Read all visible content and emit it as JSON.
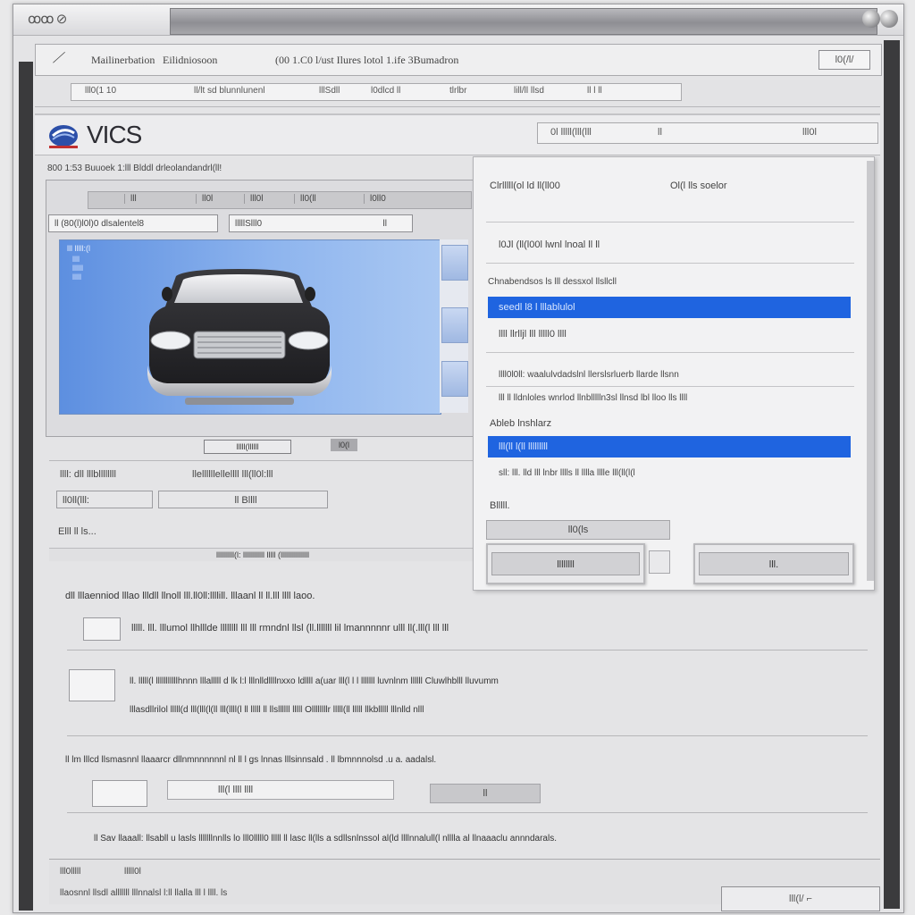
{
  "window": {
    "title_glyph": "ꝏꝏ ⊘",
    "accent_color": "#1f64e0"
  },
  "menubar": {
    "doc_icon": "document-icon",
    "item1": "Mailinerbation",
    "item2": "Eilidniosoon",
    "item3": "(00 1.C0 l/ust Ilures lotol 1.ife 3Bumadron",
    "right_button": "l0(/l/"
  },
  "toolbar": {
    "items": [
      "lll0(1 10",
      "ll/lt sd blunnlunenl",
      "lllSdll",
      "l0dlcd  ll",
      "tlrlbr",
      "lill/ll  llsd",
      "ll l ll"
    ]
  },
  "header": {
    "app_name": "VICS",
    "dropdown_left": "0l  lllll(lll(lll",
    "dropdown_mid": "ll",
    "dropdown_right": "lll0l"
  },
  "left_panel": {
    "heading": "800 1:53 Buuoek     1:lll Blddl drleolandandrl(ll!",
    "tabs": [
      "lll",
      "ll0l",
      "lll0l",
      "ll0(ll",
      "l0ll0"
    ],
    "combo1": "ll (80(l)l0l)0  dlsalentel8",
    "combo2": "lllllSlll0",
    "combo2_value": "ll",
    "viewer_label": "lll lllll:(l",
    "viewer_sub": [
      "llll",
      "llllll",
      "lllll"
    ],
    "viewer_caption": "lllll(llllll",
    "viewer_zoom": "l0(l",
    "row1_label": "llll: dll  lllbllllllll",
    "row1_value": "llellllllellellll lll(ll0l:lll",
    "field1": "ll0ll(lll:",
    "field2": "ll  Bllll",
    "row3_label": "Elll ll ls...",
    "status": "llllllllll(l: llllllllllll lllll (llllllllllllllll"
  },
  "right_panel": {
    "line1_left": "Clrlllll(ol ld ll(ll00",
    "line1_right": "Ol(l lls  soelor",
    "line2": "l0Jl (ll(l00l lwnl  lnoal   ll  ll",
    "line3": "Chnabendsos ls lll dessxol llsllcll",
    "highlight1": "seedl  l8 l lllablulol",
    "line4": "llll llrlljl lll lllll0 llll",
    "line5": "llll0l0ll: waalulvdadslnl  llerslsrluerb llarde llsnn",
    "line6": "lll ll lldnloles wnrlod  llnbllllln3sl llnsd lbl lloo lls llll",
    "line7": "Ableb lnshlarz",
    "highlight2": "lll(ll  l(ll lllllllll",
    "line8": "sll: lll.  lld  lll lnbr  lllls ll lllla lllle  lll(ll(l(l",
    "line9": "Blllll.",
    "combo": "ll0(ls",
    "button_left": "llllllll",
    "button_right": "lll."
  },
  "lower": {
    "line1": "dll  lllaenniod  lllao  llldll llnoll lll.ll0ll:llllill.  lllaanl ll  ll.lll llll  laoo.",
    "line2": "lllll. lll. lllumol llhlllde  llllllll lll  lll rmndnl  llsl (ll.lllllll lil  lmannnnnr   ulll  ll(.lll(l lll  lll",
    "line3": "ll. lllll(l  lllllllllllhnnn lllalllll d lk  l:l  lllnlldllllnxxo  ldllll a(uar  lll(l l l lllllll luvnlnm  llllll  Cluwlhblll lluvumm",
    "line4": "lllasdllrilol  lllll(d  lll(lll(l(ll  lll(llll(l ll lllll ll  llsllllll  lllll  Ollllllllr  lllll(ll  lllll  llkblllll  lllnlld  nlll",
    "line5": "ll lm  lllcd  llsmasnnl  llaaarcr  dllnmnnnnnnl nl  ll  l  gs lnnas lllsinnsald  .  ll  lbmnnnolsd  .u  a.  aadalsl.",
    "field_label": "lll(l llll llll",
    "field_value": "ll",
    "line6": "ll  Sav  llaaall:  llsabll  u  lasls  lllllllnnlls  lo  lll0lllll0  lllll ll  lasc  ll(lls  a  sdllsnlnssol  al(ld  llllnnalull(l  nlllla  al  llnaaaclu  annndarals."
  },
  "statusbar": {
    "left1": "lll0lllll",
    "left2": "lllll0l",
    "left3": "llaosnnl llsdl alllllll lllnnalsl l:ll  llalla  lll l llll. ls",
    "button": "lll(l/ ⌐"
  }
}
